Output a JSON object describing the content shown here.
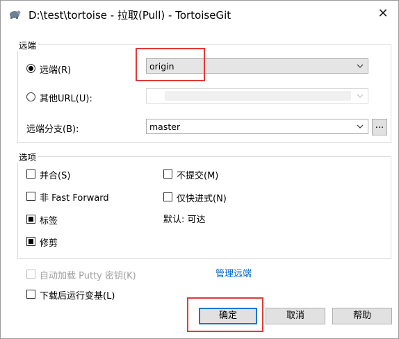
{
  "window": {
    "title": "D:\\test\\tortoise - 拉取(Pull) - TortoiseGit",
    "close_glyph": "✕"
  },
  "remote_group": {
    "label": "远端",
    "remote_radio_label": "远端(R)",
    "remote_value": "origin",
    "other_url_label": "其他URL(U):",
    "other_url_value": "",
    "remote_branch_label": "远端分支(B):",
    "remote_branch_value": "master",
    "browse_label": "..."
  },
  "options_group": {
    "label": "选项",
    "merge_label": "并合(S)",
    "merge_checked": false,
    "no_commit_label": "不提交(M)",
    "no_commit_checked": false,
    "no_ff_label": "非 Fast Forward",
    "no_ff_checked": false,
    "ff_only_label": "仅快进式(N)",
    "ff_only_checked": false,
    "default_text": "默认: 可达",
    "tags_label": "标签",
    "tags_checked": true,
    "prune_label": "修剪",
    "prune_checked": true
  },
  "autoload_putty_label": "自动加载 Putty 密钥(K)",
  "manage_remotes_label": "管理远端",
  "rebase_after_fetch_label": "下载后运行变基(L)",
  "buttons": {
    "ok": "确定",
    "cancel": "取消",
    "help": "帮助"
  },
  "colors": {
    "accent": "#0078d7",
    "highlight_box": "#e53935",
    "link": "#0066cc"
  }
}
